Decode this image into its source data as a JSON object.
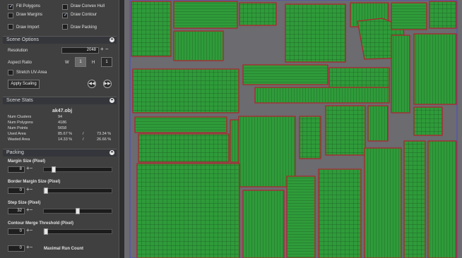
{
  "display": {
    "fill_polygons": "Fill Polygons",
    "draw_margins": "Draw Margins",
    "draw_import": "Draw Import",
    "draw_convex_hull": "Draw Convex Hull",
    "draw_contour": "Draw Contour",
    "draw_packing": "Draw Packing"
  },
  "scene_options": {
    "header": "Scene Options",
    "resolution_label": "Resolution",
    "resolution_value": "2048",
    "aspect_ratio_label": "Aspect Ratio",
    "w_label": "W",
    "w_value": "1",
    "h_label": "H",
    "h_value": "1",
    "stretch_label": "Stretch UV-Area",
    "apply_label": "Apply Scaling",
    "prev_glyph": "◀◀",
    "next_glyph": "▶▶"
  },
  "scene_stats": {
    "header": "Scene Stats",
    "filename": "ak47.obj",
    "rows": [
      {
        "label": "Num Clusters",
        "v1": "94",
        "sep": "",
        "v2": ""
      },
      {
        "label": "Num Polygons",
        "v1": "4186",
        "sep": "",
        "v2": ""
      },
      {
        "label": "Num Points",
        "v1": "5658",
        "sep": "",
        "v2": ""
      },
      {
        "label": "Used Area",
        "v1": "85.67 %",
        "sep": "/",
        "v2": "73.34 %"
      },
      {
        "label": "Wasted Area",
        "v1": "14.33 %",
        "sep": "/",
        "v2": "26.66 %"
      }
    ]
  },
  "packing": {
    "header": "Packing",
    "margin_label": "Margin Size (Pixel)",
    "margin_value": "8",
    "margin_level": 0.12,
    "border_label": "Border Margin Size (Pixel)",
    "border_value": "0",
    "border_level": 0.0,
    "step_label": "Step Size (Pixel)",
    "step_value": "32",
    "step_level": 0.5,
    "contour_label": "Contour Merge Threshold (Pixel)",
    "contour_value": "0",
    "contour_level": 0.0,
    "maxrun_label": "Maximal Run Count",
    "maxrun_value": "0"
  },
  "glyphs": {
    "collapse": "⏶",
    "plus": "+",
    "minus": "−"
  }
}
